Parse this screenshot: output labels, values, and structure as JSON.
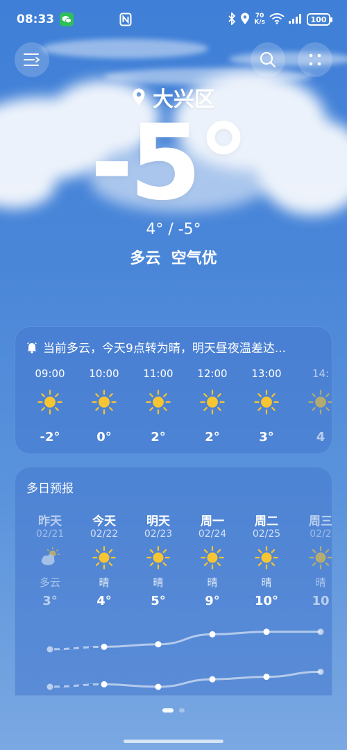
{
  "status_bar": {
    "time": "08:33",
    "network_speed_value": "70",
    "network_speed_unit": "K/s",
    "battery": "100",
    "icons": [
      "wechat-icon",
      "nfc-icon",
      "bluetooth-icon",
      "location-icon",
      "wifi-icon",
      "signal-icon"
    ]
  },
  "header": {
    "location": "大兴区"
  },
  "current": {
    "temperature": "-5°",
    "range": "4° / -5°",
    "condition": "多云",
    "air_quality": "空气优"
  },
  "hourly": {
    "alert": "当前多云，今天9点转为晴，明天昼夜温差达...",
    "items": [
      {
        "time": "09:00",
        "icon": "sun-icon",
        "temp": "-2°"
      },
      {
        "time": "10:00",
        "icon": "sun-icon",
        "temp": "0°"
      },
      {
        "time": "11:00",
        "icon": "sun-icon",
        "temp": "2°"
      },
      {
        "time": "12:00",
        "icon": "sun-icon",
        "temp": "2°"
      },
      {
        "time": "13:00",
        "icon": "sun-icon",
        "temp": "3°"
      },
      {
        "time": "14:",
        "icon": "sun-icon",
        "temp": "4"
      }
    ]
  },
  "daily": {
    "title": "多日预报",
    "items": [
      {
        "day": "昨天",
        "date": "02/21",
        "icon": "partly-cloudy-icon",
        "condition": "多云",
        "high": "3°",
        "high_value": 3,
        "low_value": -8
      },
      {
        "day": "今天",
        "date": "02/22",
        "icon": "sun-icon",
        "condition": "晴",
        "high": "4°",
        "high_value": 4,
        "low_value": -7
      },
      {
        "day": "明天",
        "date": "02/23",
        "icon": "sun-icon",
        "condition": "晴",
        "high": "5°",
        "high_value": 5,
        "low_value": -8
      },
      {
        "day": "周一",
        "date": "02/24",
        "icon": "sun-icon",
        "condition": "晴",
        "high": "9°",
        "high_value": 9,
        "low_value": -5
      },
      {
        "day": "周二",
        "date": "02/25",
        "icon": "sun-icon",
        "condition": "晴",
        "high": "10°",
        "high_value": 10,
        "low_value": -4
      },
      {
        "day": "周三",
        "date": "02/2",
        "icon": "sun-icon",
        "condition": "晴",
        "high": "10",
        "high_value": 10,
        "low_value": -2
      }
    ]
  },
  "pager": {
    "pages": 2,
    "active": 0
  },
  "colors": {
    "sky_top": "#3f7fd7",
    "sky_bottom": "#7aa8e2",
    "sun": "#f7c531"
  }
}
